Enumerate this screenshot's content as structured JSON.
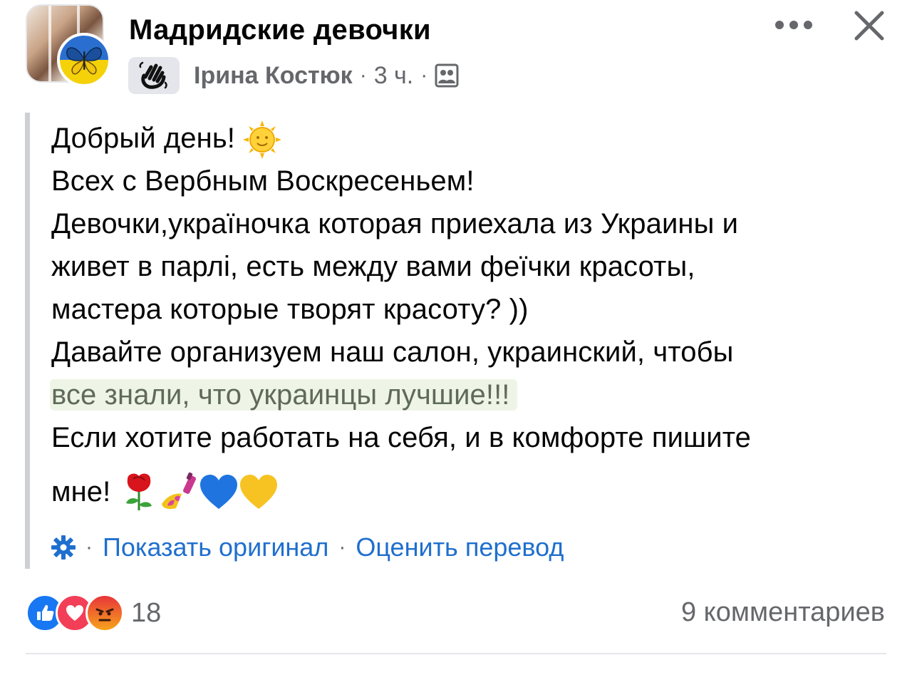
{
  "header": {
    "group_name": "Мадридские девочки",
    "author": "Ірина Костюк",
    "time": "3 ч.",
    "separator": "·"
  },
  "post": {
    "lines": [
      "Добрый день!",
      "Всех с Вербным Воскресеньем!",
      "Девочки,україночка которая приехала из Украины и",
      "живет в парлі, есть между вами феїчки красоты,",
      "мастера которые творят красоту? ))",
      "Давайте организуем наш салон, украинский, чтобы",
      "все знали, что украинцы лучшие!!!",
      "Если хотите работать на себя, и в комфорте пишите",
      "мне!"
    ],
    "highlight_color": "#eef5e6"
  },
  "translation": {
    "show_original": "Показать оригинал",
    "rate_translation": "Оценить перевод"
  },
  "footer": {
    "reaction_count": "18",
    "comments": "9 комментариев"
  },
  "colors": {
    "link": "#1f6fce",
    "secondary_text": "#65676b",
    "like": "#1877f2",
    "love": "#f33e58",
    "angry": "#f7714b"
  },
  "icons": [
    "butterfly-flag-icon",
    "waving-hand-icon",
    "group-members-icon",
    "more-icon",
    "close-icon",
    "sun-face-icon",
    "rose-icon",
    "nail-polish-icon",
    "blue-heart-icon",
    "yellow-heart-icon",
    "gear-icon",
    "like-reaction-icon",
    "love-reaction-icon",
    "angry-reaction-icon"
  ]
}
